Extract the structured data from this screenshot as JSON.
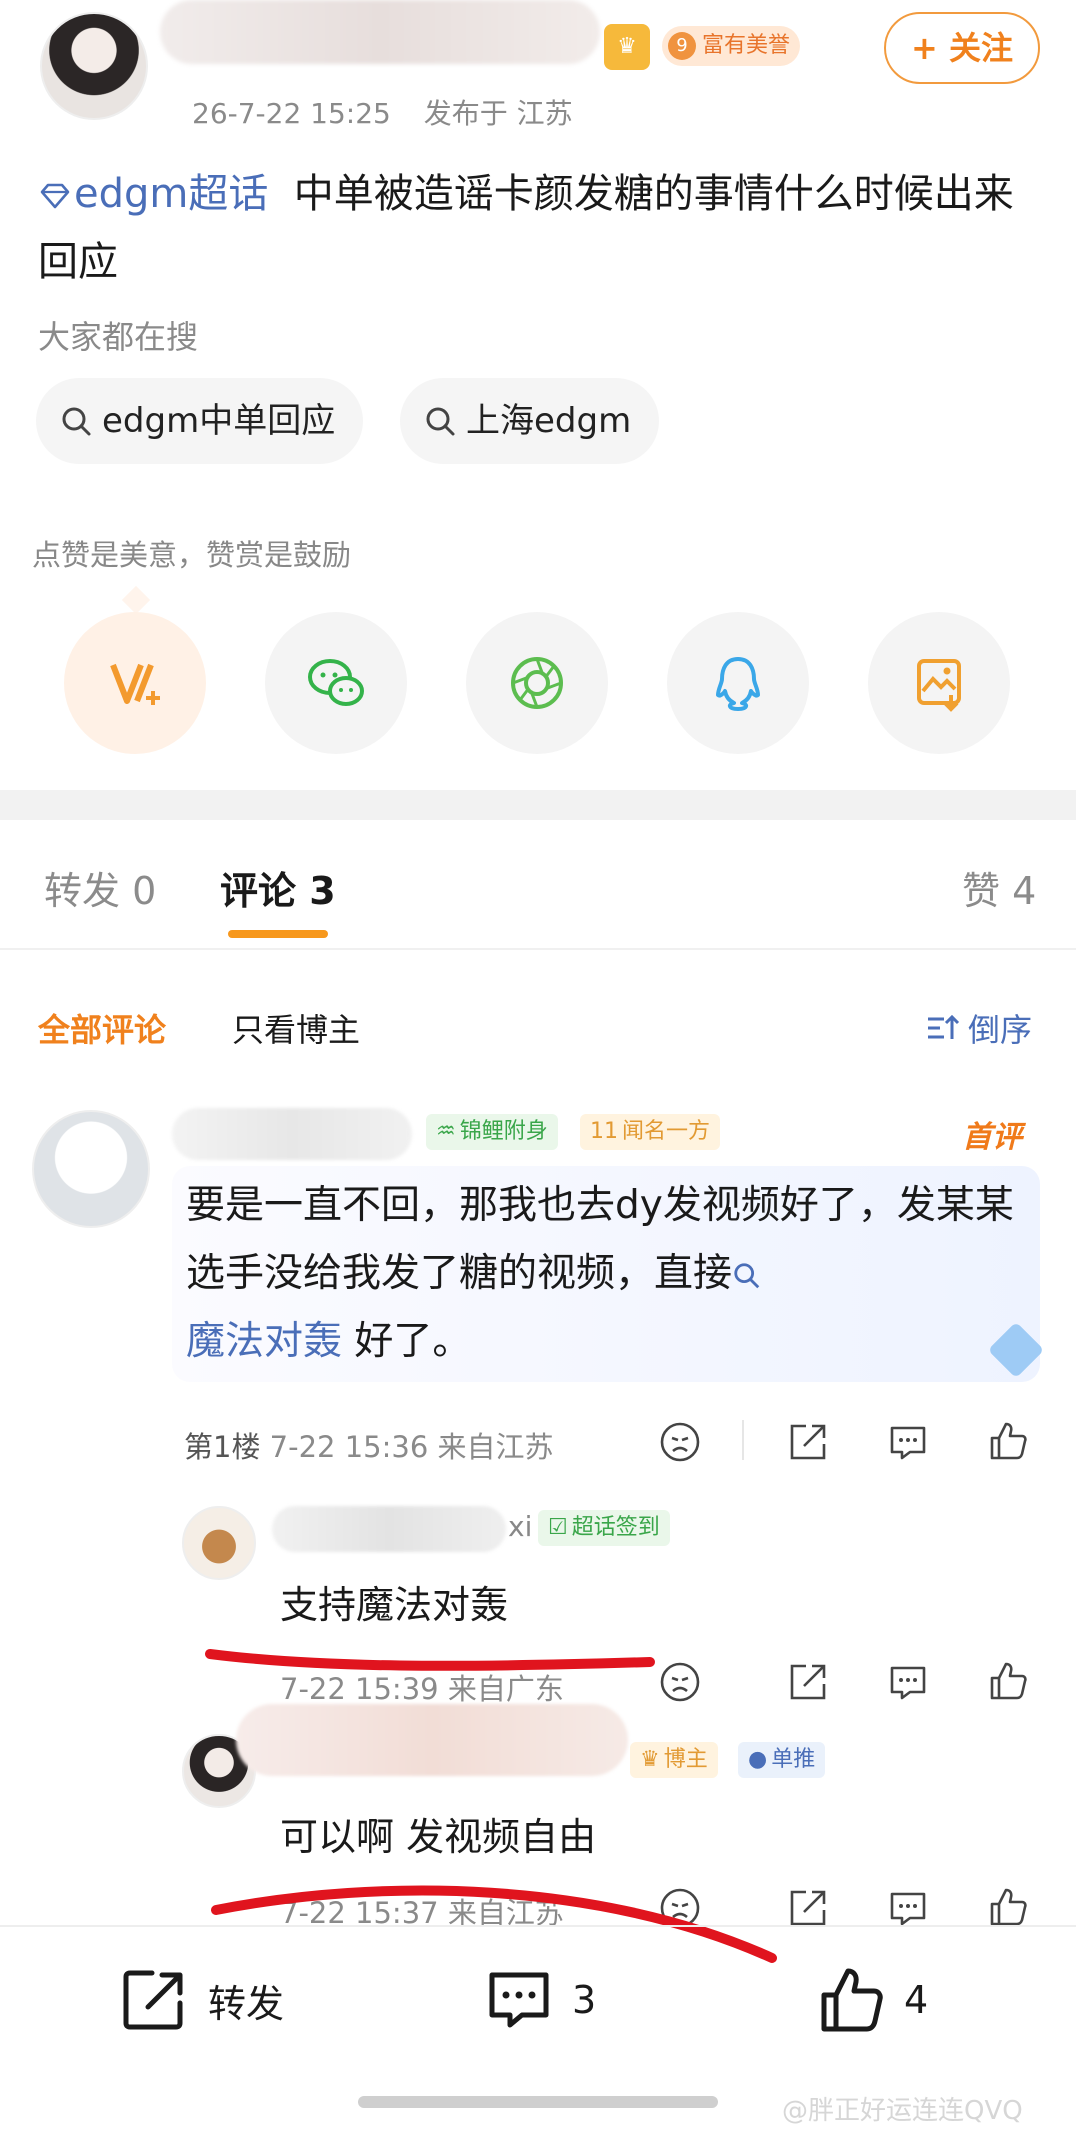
{
  "header": {
    "rich_badge_level": "9",
    "rich_badge_label": "富有美誉",
    "follow_label": "+ 关注",
    "post_time": "26-7-22 15:25",
    "post_location": "发布于 江苏"
  },
  "post": {
    "topic": "edgm超话",
    "text": "中单被造谣卡颜发糖的事情什么时候出来回应"
  },
  "search": {
    "title": "大家都在搜",
    "chips": [
      "edgm中单回应",
      "上海edgm"
    ]
  },
  "reward": {
    "tip": "点赞是美意，赞赏是鼓励",
    "share_icons": [
      "vip-reward-icon",
      "wechat-icon",
      "moments-icon",
      "qq-icon",
      "save-image-icon"
    ]
  },
  "tabs": {
    "repost": "转发 0",
    "comment": "评论 3",
    "like": "赞 4"
  },
  "filters": {
    "all": "全部评论",
    "author_only": "只看博主",
    "sort": "倒序"
  },
  "comment": {
    "tag1": "锦鲤附身",
    "tag2_level": "11",
    "tag2": "闻名一方",
    "first_label": "首评",
    "text_part1": "要是一直不回，那我也去dy发视频好了，发某某选手没给我发了糖的视频，直接",
    "link": "魔法对轰",
    "text_part2": " 好了。",
    "floor": "第1楼",
    "time": "7-22 15:36",
    "location": "来自江苏"
  },
  "replies": [
    {
      "name_suffix": "xi",
      "tag": "超话签到",
      "text": "支持魔法对轰",
      "meta": "7-22 15:39  来自广东"
    },
    {
      "tag1": "博主",
      "tag2": "单推",
      "text": "可以啊 发视频自由",
      "meta": "7-22 15:37  来自江苏"
    }
  ],
  "bottom_bar": {
    "repost": "转发",
    "comment_count": "3",
    "like_count": "4"
  },
  "watermark": "@胖正好运连连QVQ",
  "colors": {
    "accent_orange": "#f0811d",
    "link_blue": "#4a6eb8",
    "annotation_red": "#e0141e"
  }
}
